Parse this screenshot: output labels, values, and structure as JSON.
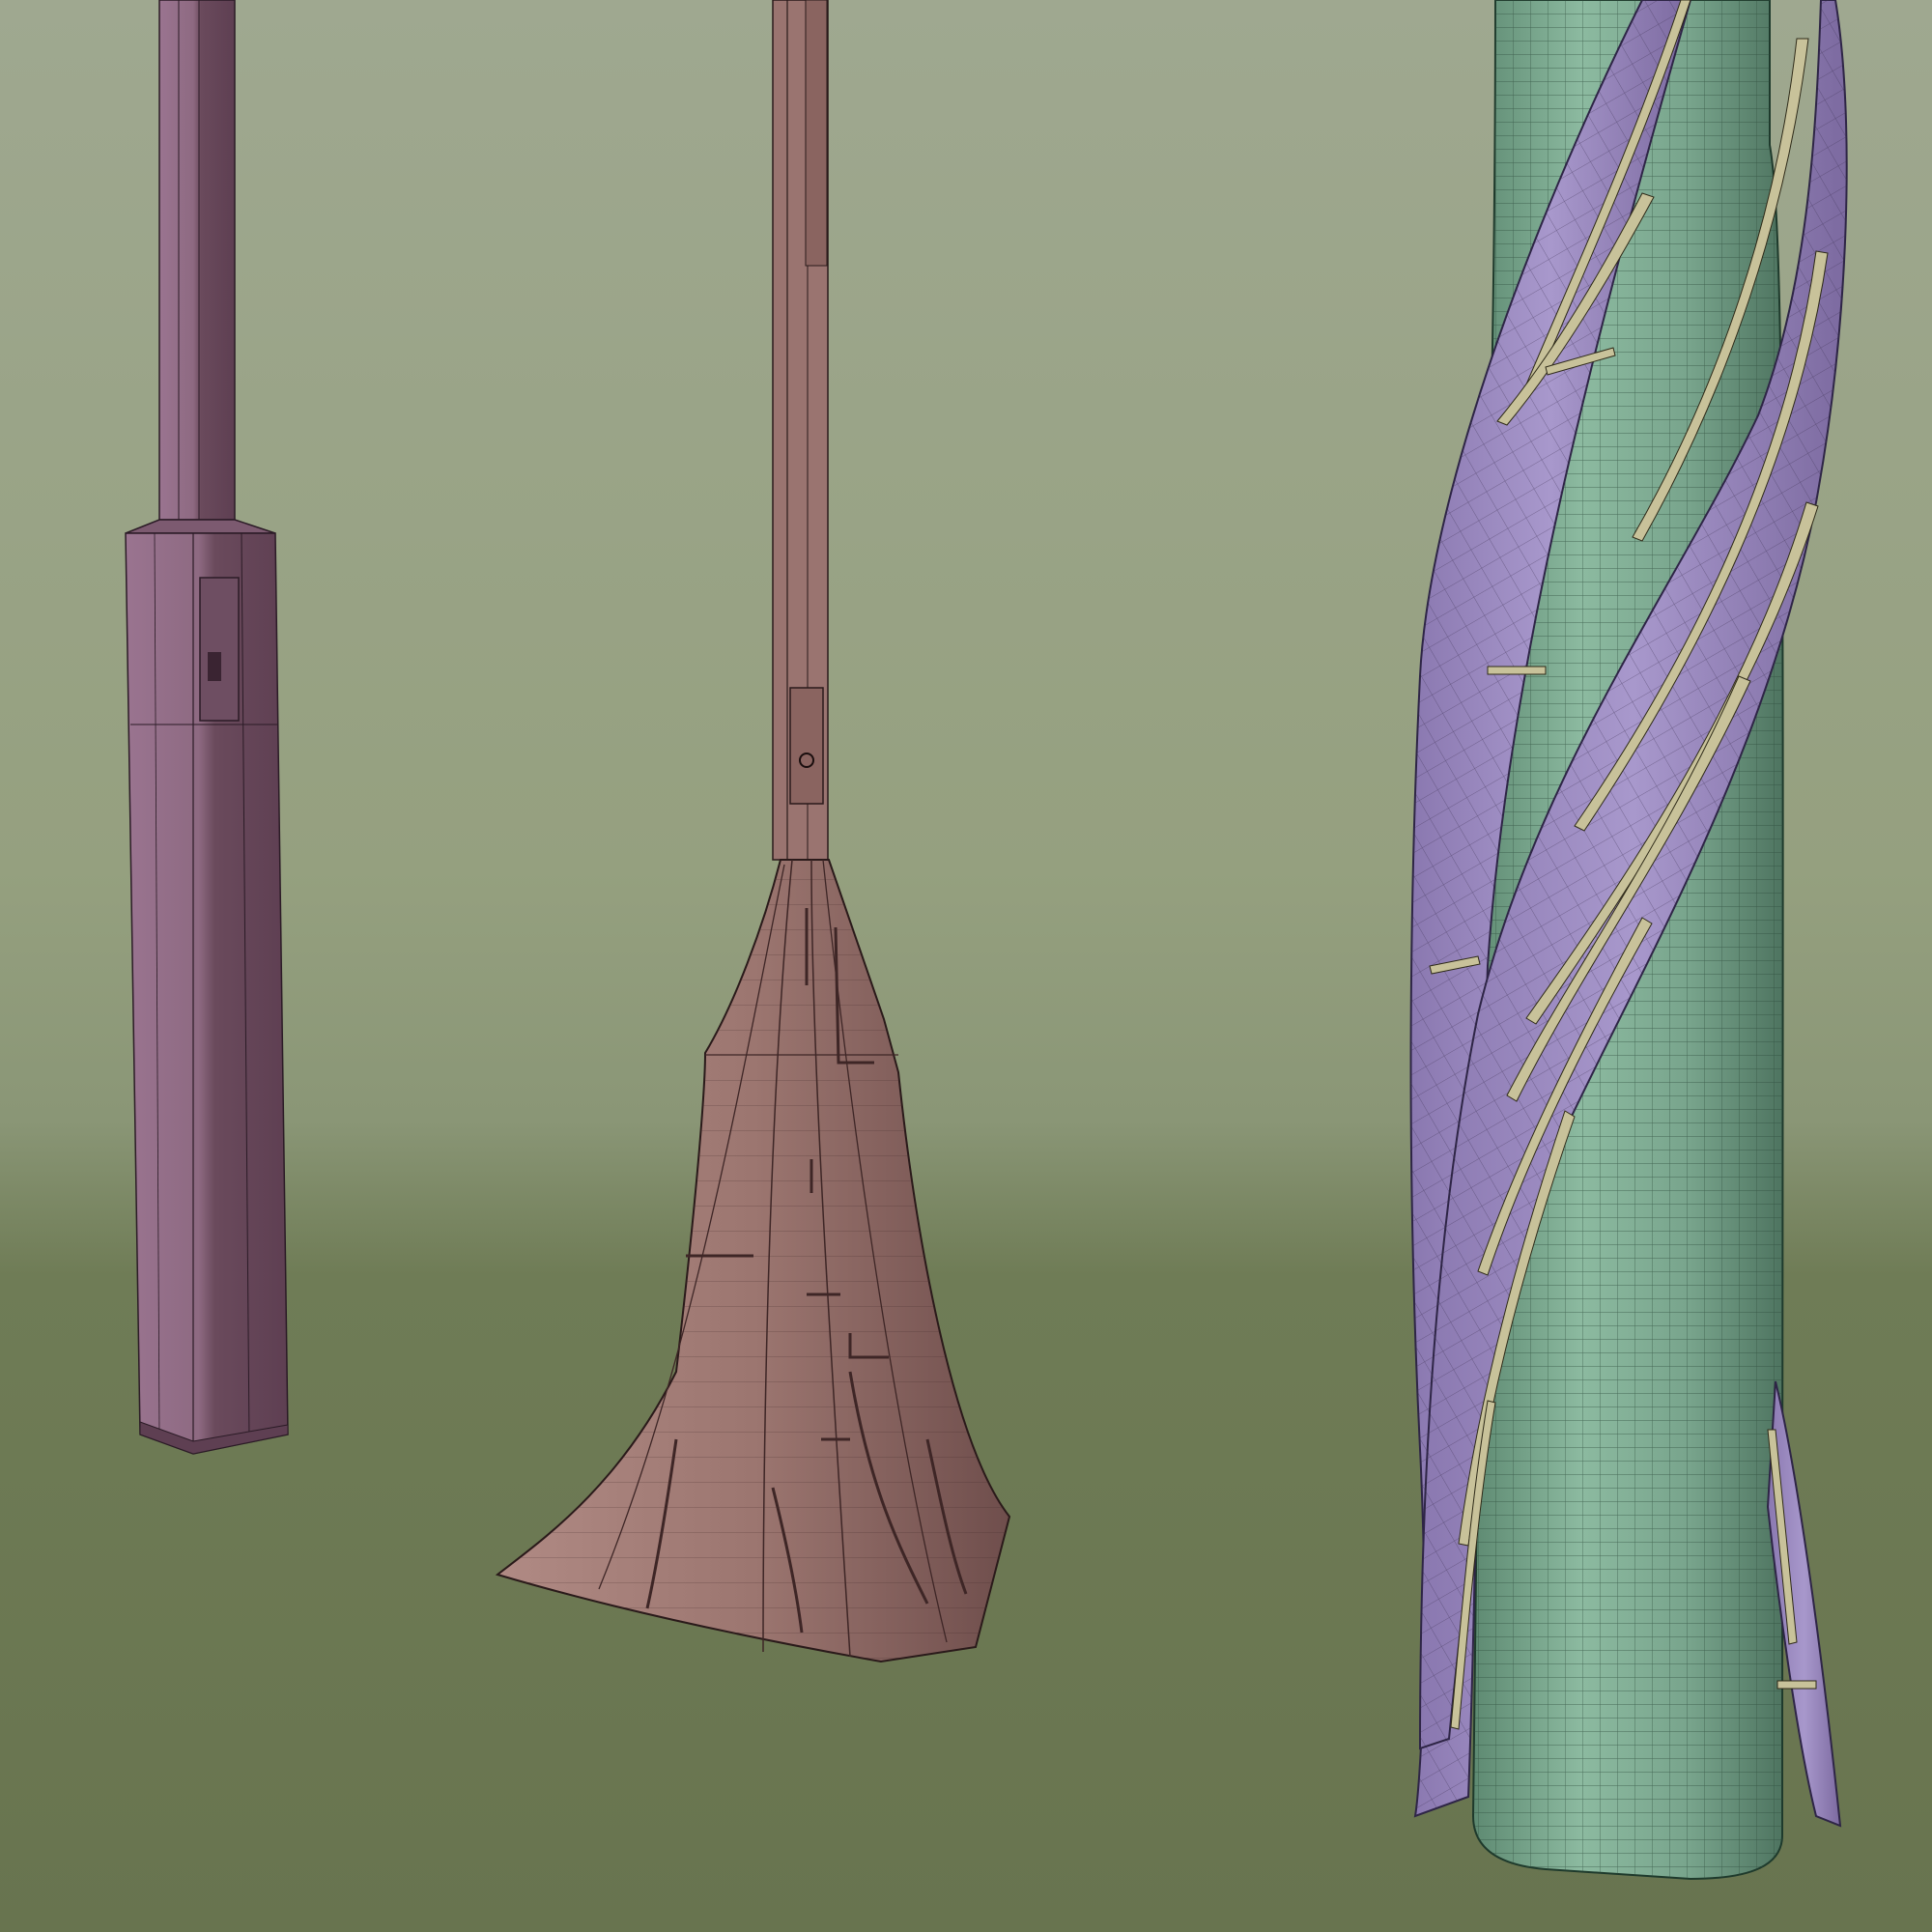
{
  "scene": {
    "background_top": "#9fa890",
    "background_bottom": "#68744f",
    "objects": [
      {
        "name": "square-post",
        "color": "#8e6a82"
      },
      {
        "name": "flared-base-post",
        "color": "#a07c76"
      },
      {
        "name": "twisted-ribbon-tower",
        "core_color": "#7aa88f",
        "ribbon_color": "#9c8cc0",
        "slat_color": "#c8c29a"
      }
    ]
  }
}
